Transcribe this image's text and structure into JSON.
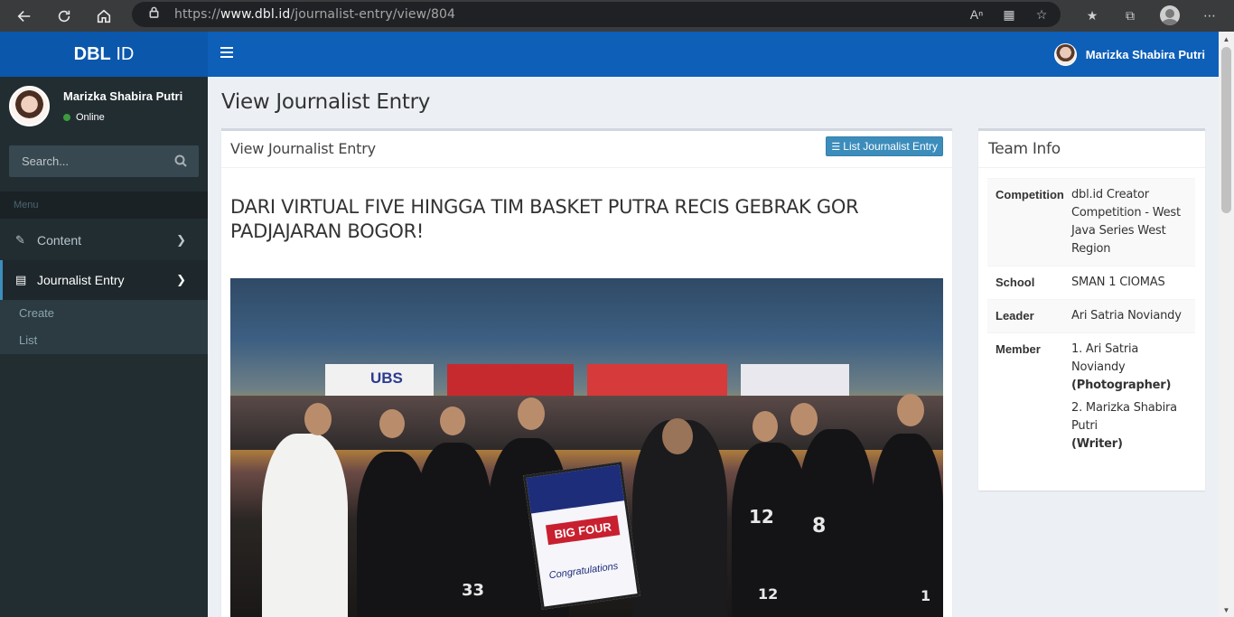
{
  "browser": {
    "url_prefix": "https://",
    "url_domain": "www.dbl.id",
    "url_path": "/journalist-entry/view/804"
  },
  "navbar": {
    "logo_bold": "DBL",
    "logo_rest": " ID",
    "user_name": "Marizka Shabira Putri",
    "color": "#0d5fb8"
  },
  "sidebar": {
    "user_name": "Marizka Shabira Putri",
    "status": "Online",
    "search_placeholder": "Search...",
    "menu_header": "Menu",
    "items": [
      {
        "label": "Content",
        "icon": "pencil-icon"
      },
      {
        "label": "Journalist Entry",
        "icon": "newspaper-icon"
      }
    ],
    "submenu": [
      {
        "label": "Create"
      },
      {
        "label": "List"
      }
    ]
  },
  "page": {
    "title": "View Journalist Entry"
  },
  "main_box": {
    "title": "View Journalist Entry",
    "list_button": "List Journalist Entry",
    "article_title": "DARI VIRTUAL FIVE HINGGA TIM BASKET PUTRA RECIS GEBRAK GOR PADJAJARAN BOGOR!",
    "photo": {
      "board_title": "BIG FOUR",
      "board_footer": "Congratulations",
      "banner_left": "UBS",
      "jersey_numbers": [
        "33",
        "12",
        "8",
        "12",
        "1"
      ]
    }
  },
  "team_info": {
    "title": "Team Info",
    "rows": [
      {
        "key": "Competition",
        "value": "dbl.id Creator Competition - West Java Series West Region"
      },
      {
        "key": "School",
        "value": "SMAN 1 CIOMAS"
      },
      {
        "key": "Leader",
        "value": "Ari Satria Noviandy"
      }
    ],
    "member_key": "Member",
    "members": [
      {
        "name": "1. Ari Satria Noviandy",
        "role": "(Photographer)"
      },
      {
        "name": "2. Marizka Shabira Putri",
        "role": "(Writer)"
      }
    ]
  }
}
